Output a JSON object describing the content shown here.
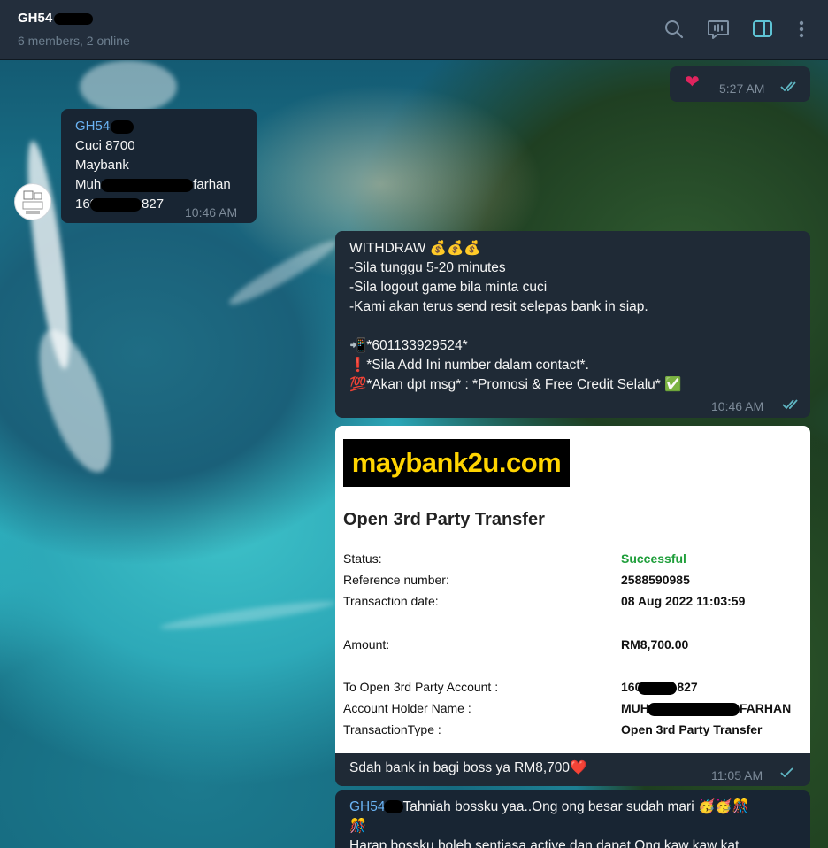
{
  "header": {
    "title": "GH54",
    "subtitle": "6 members, 2 online"
  },
  "messages": {
    "heart": {
      "emoji": "❤️",
      "time": "5:27 AM"
    },
    "incoming1": {
      "sender": "GH54",
      "line1": "Cuci 8700",
      "line2": "Maybank",
      "line3a": "Muh",
      "line3b": "farhan",
      "line4a": "160",
      "line4b": "827",
      "time": "10:46 AM"
    },
    "withdraw": {
      "line1": "WITHDRAW 💰💰💰",
      "line2": "-Sila tunggu 5-20 minutes",
      "line3": "-Sila logout game bila minta cuci",
      "line4": "-Kami akan terus send resit selepas bank in siap.",
      "line5": "📲*601133929524*",
      "line6": "❗*Sila Add Ini number dalam contact*.",
      "line7": "💯*Akan dpt msg* : *Promosi & Free Credit Selalu* ✅",
      "time": "10:46 AM"
    },
    "receipt": {
      "logo": "maybank2u.com",
      "title": "Open 3rd Party Transfer",
      "rows": [
        {
          "label": "Status:",
          "value": "Successful"
        },
        {
          "label": "Reference number:",
          "value": "2588590985"
        },
        {
          "label": "Transaction date:",
          "value": "08 Aug 2022 11:03:59"
        },
        {
          "label": "Amount:",
          "value": "RM8,700.00"
        },
        {
          "label": "To Open 3rd Party Account :",
          "value_a": "160",
          "value_b": "827"
        },
        {
          "label": "Account Holder Name :",
          "value_a": "MUH",
          "value_b": "FARHAN"
        },
        {
          "label": "TransactionType :",
          "value": "Open 3rd Party Transfer"
        }
      ],
      "status_color": "#1e9e3a"
    },
    "caption": {
      "text": "Sdah bank in bagi boss ya RM8,700❤️",
      "time": "11:05 AM"
    },
    "last": {
      "sender": "GH54",
      "text": "Tahniah bossku yaa..Ong ong besar sudah mari 🥳🥳🎊",
      "text2": "🎊",
      "text3": "Harap bossku boleh sentiasa active dan dapat Ong kaw kaw kat"
    }
  },
  "colors": {
    "accent": "#6ab3f3",
    "check": "#5fb5c2",
    "header_bg": "#232e3c"
  }
}
